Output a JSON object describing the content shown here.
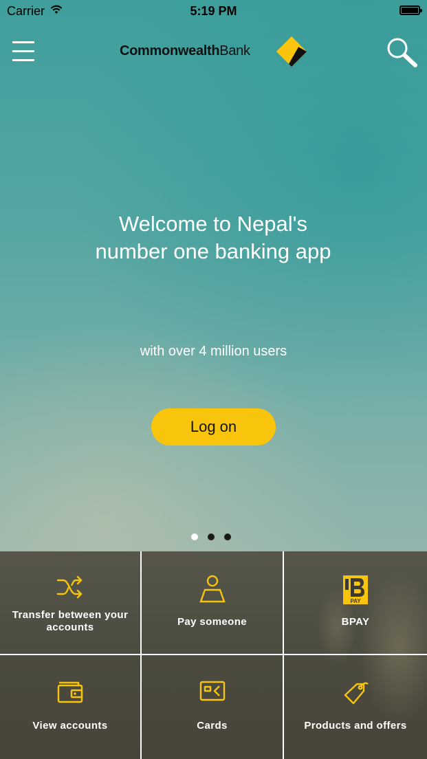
{
  "status_bar": {
    "carrier": "Carrier",
    "time": "5:19 PM"
  },
  "header": {
    "brand_bold": "Commonwealth",
    "brand_regular": "Bank",
    "menu_icon": "hamburger-menu-icon",
    "search_icon": "search-icon"
  },
  "hero": {
    "headline": "Welcome to Nepal's number one banking app",
    "subtitle": "with over 4 million users",
    "logon_label": "Log on",
    "carousel": {
      "pages": 3,
      "active_index": 0
    }
  },
  "quick_actions": [
    {
      "label": "Transfer between your accounts",
      "icon": "shuffle-transfer-icon"
    },
    {
      "label": "Pay someone",
      "icon": "person-icon"
    },
    {
      "label": "BPAY",
      "icon": "bpay-logo-icon"
    },
    {
      "label": "View accounts",
      "icon": "wallet-icon"
    },
    {
      "label": "Cards",
      "icon": "card-icon"
    },
    {
      "label": "Products and offers",
      "icon": "tag-icon"
    }
  ],
  "colors": {
    "accent_yellow": "#f8c50c",
    "tile_bg": "#4f4e43",
    "text_white": "#ffffff"
  }
}
